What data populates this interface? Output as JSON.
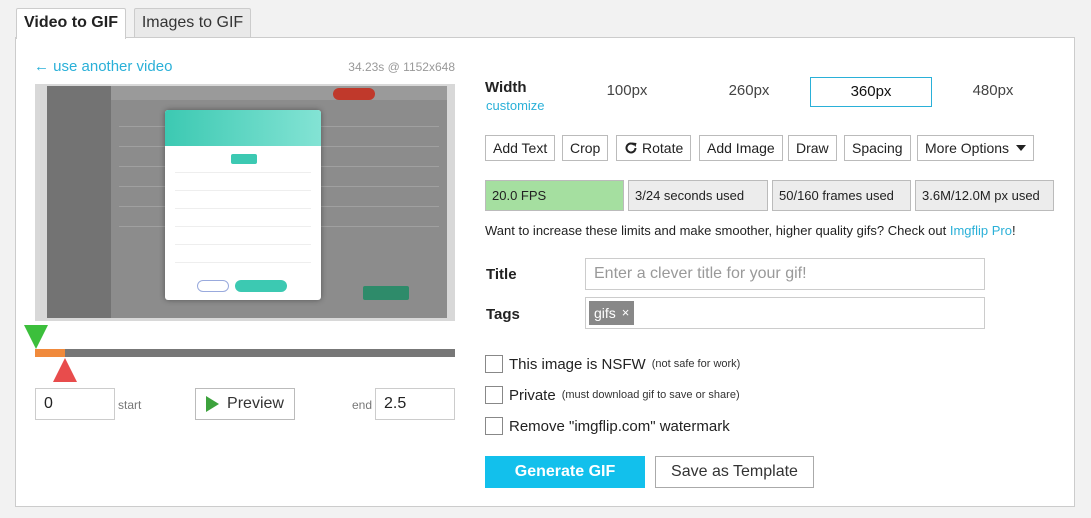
{
  "tabs": [
    {
      "label": "Video to GIF",
      "active": true
    },
    {
      "label": "Images to GIF",
      "active": false
    }
  ],
  "video": {
    "back_link": "← use another video",
    "meta": "34.23s @ 1152x648",
    "trim_start_fraction": 0,
    "trim_end_fraction": 0.073
  },
  "trim": {
    "start_value": "0",
    "start_label": "start",
    "preview_label": "Preview",
    "end_label": "end",
    "end_value": "2.5"
  },
  "width": {
    "label": "Width",
    "customize": "customize",
    "options": [
      "100px",
      "260px",
      "360px",
      "480px"
    ],
    "selected": "360px"
  },
  "tools": {
    "add_text": "Add Text",
    "crop": "Crop",
    "rotate": "Rotate",
    "add_image": "Add Image",
    "draw": "Draw",
    "spacing": "Spacing",
    "more_options": "More Options"
  },
  "stats": {
    "fps": "20.0 FPS",
    "seconds": "3/24 seconds used",
    "frames": "50/160 frames used",
    "px": "3.6M/12.0M px used"
  },
  "upgrade": {
    "text": "Want to increase these limits and make smoother, higher quality gifs? Check out ",
    "link": "Imgflip Pro",
    "suffix": "!"
  },
  "form": {
    "title_label": "Title",
    "title_placeholder": "Enter a clever title for your gif!",
    "tags_label": "Tags",
    "tags": [
      "gifs"
    ],
    "tag_remove": "×"
  },
  "options": {
    "nsfw_label": "This image is NSFW",
    "nsfw_note": "(not safe for work)",
    "private_label": "Private",
    "private_note": "(must download gif to save or share)",
    "watermark_label": "Remove \"imgflip.com\" watermark"
  },
  "actions": {
    "generate": "Generate GIF",
    "save_template": "Save as Template"
  },
  "colors": {
    "accent": "#12c0ec",
    "link": "#2ab0d8",
    "fps_fill": "#a5dfa0",
    "trim_start_handle": "#3cbf3c",
    "trim_end_handle": "#e84c4c",
    "trim_range": "#f08a3c"
  }
}
